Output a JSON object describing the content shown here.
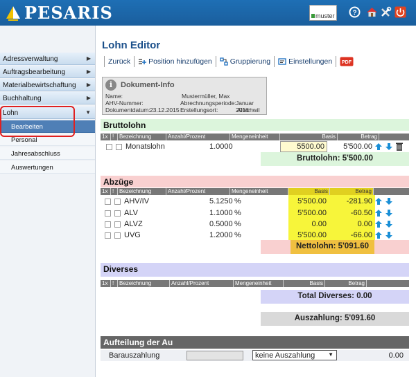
{
  "app": {
    "logo_text": "PESARIS",
    "user_label": "muster"
  },
  "sidebar": {
    "items": [
      {
        "label": "Adressverwaltung"
      },
      {
        "label": "Auftragsbearbeitung"
      },
      {
        "label": "Materialbewirtschaftung"
      },
      {
        "label": "Buchhaltung"
      },
      {
        "label": "Lohn"
      }
    ],
    "subitems": [
      {
        "label": "Bearbeiten",
        "active": true
      },
      {
        "label": "Personal"
      },
      {
        "label": "Jahresabschluss"
      },
      {
        "label": "Auswertungen"
      }
    ]
  },
  "page": {
    "title": "Lohn Editor"
  },
  "toolbar": {
    "back": "Zurück",
    "add_position": "Position hinzufügen",
    "grouping": "Gruppierung",
    "settings": "Einstellungen",
    "pdf_icon": "pdf-icon"
  },
  "docinfo": {
    "title": "Dokument-Info",
    "name_label": "Name:",
    "name_value": "Mustermüller, Max",
    "ahv_label": "AHV-Nummer:",
    "period_label": "Abrechnungsperiode:",
    "period_value": "Januar 2016",
    "date_label": "Dokumentdatum:",
    "date_value": "23.12.2015",
    "place_label": "Erstellungsort:",
    "place_value": "Allschwil"
  },
  "columns": {
    "c1": "1x",
    "c2": "!",
    "bez": "Bezeichnung",
    "anz": "Anzahl/Prozent",
    "menge": "Mengeneinheit",
    "basis": "Basis",
    "betrag": "Betrag"
  },
  "bruttolohn": {
    "title": "Bruttolohn",
    "rows": [
      {
        "bez": "Monatslohn",
        "anz": "1.0000",
        "basis": "5500.00",
        "betrag": "5'500.00"
      }
    ],
    "total": "Bruttolohn: 5'500.00"
  },
  "abzuege": {
    "title": "Abzüge",
    "rows": [
      {
        "bez": "AHV/IV",
        "anz": "5.1250",
        "unit": "%",
        "basis": "5'500.00",
        "betrag": "-281.90"
      },
      {
        "bez": "ALV",
        "anz": "1.1000",
        "unit": "%",
        "basis": "5'500.00",
        "betrag": "-60.50"
      },
      {
        "bez": "ALVZ",
        "anz": "0.5000",
        "unit": "%",
        "basis": "0.00",
        "betrag": "0.00"
      },
      {
        "bez": "UVG",
        "anz": "1.2000",
        "unit": "%",
        "basis": "5'500.00",
        "betrag": "-66.00"
      }
    ],
    "total": "Nettolohn: 5'091.60"
  },
  "diverses": {
    "title": "Diverses",
    "total": "Total Diverses: 0.00"
  },
  "auszahlung": {
    "total": "Auszahlung: 5'091.60"
  },
  "aufteilung": {
    "title": "Aufteilung der Au",
    "row_label": "Barauszahlung",
    "select_value": "keine Auszahlung",
    "amount": "0.00"
  },
  "colors": {
    "brutto_bg": "#dcf5dc",
    "abzug_bg": "#f9d0d0",
    "divers_bg": "#d4d4f7",
    "brand": "#1e6fb5"
  }
}
